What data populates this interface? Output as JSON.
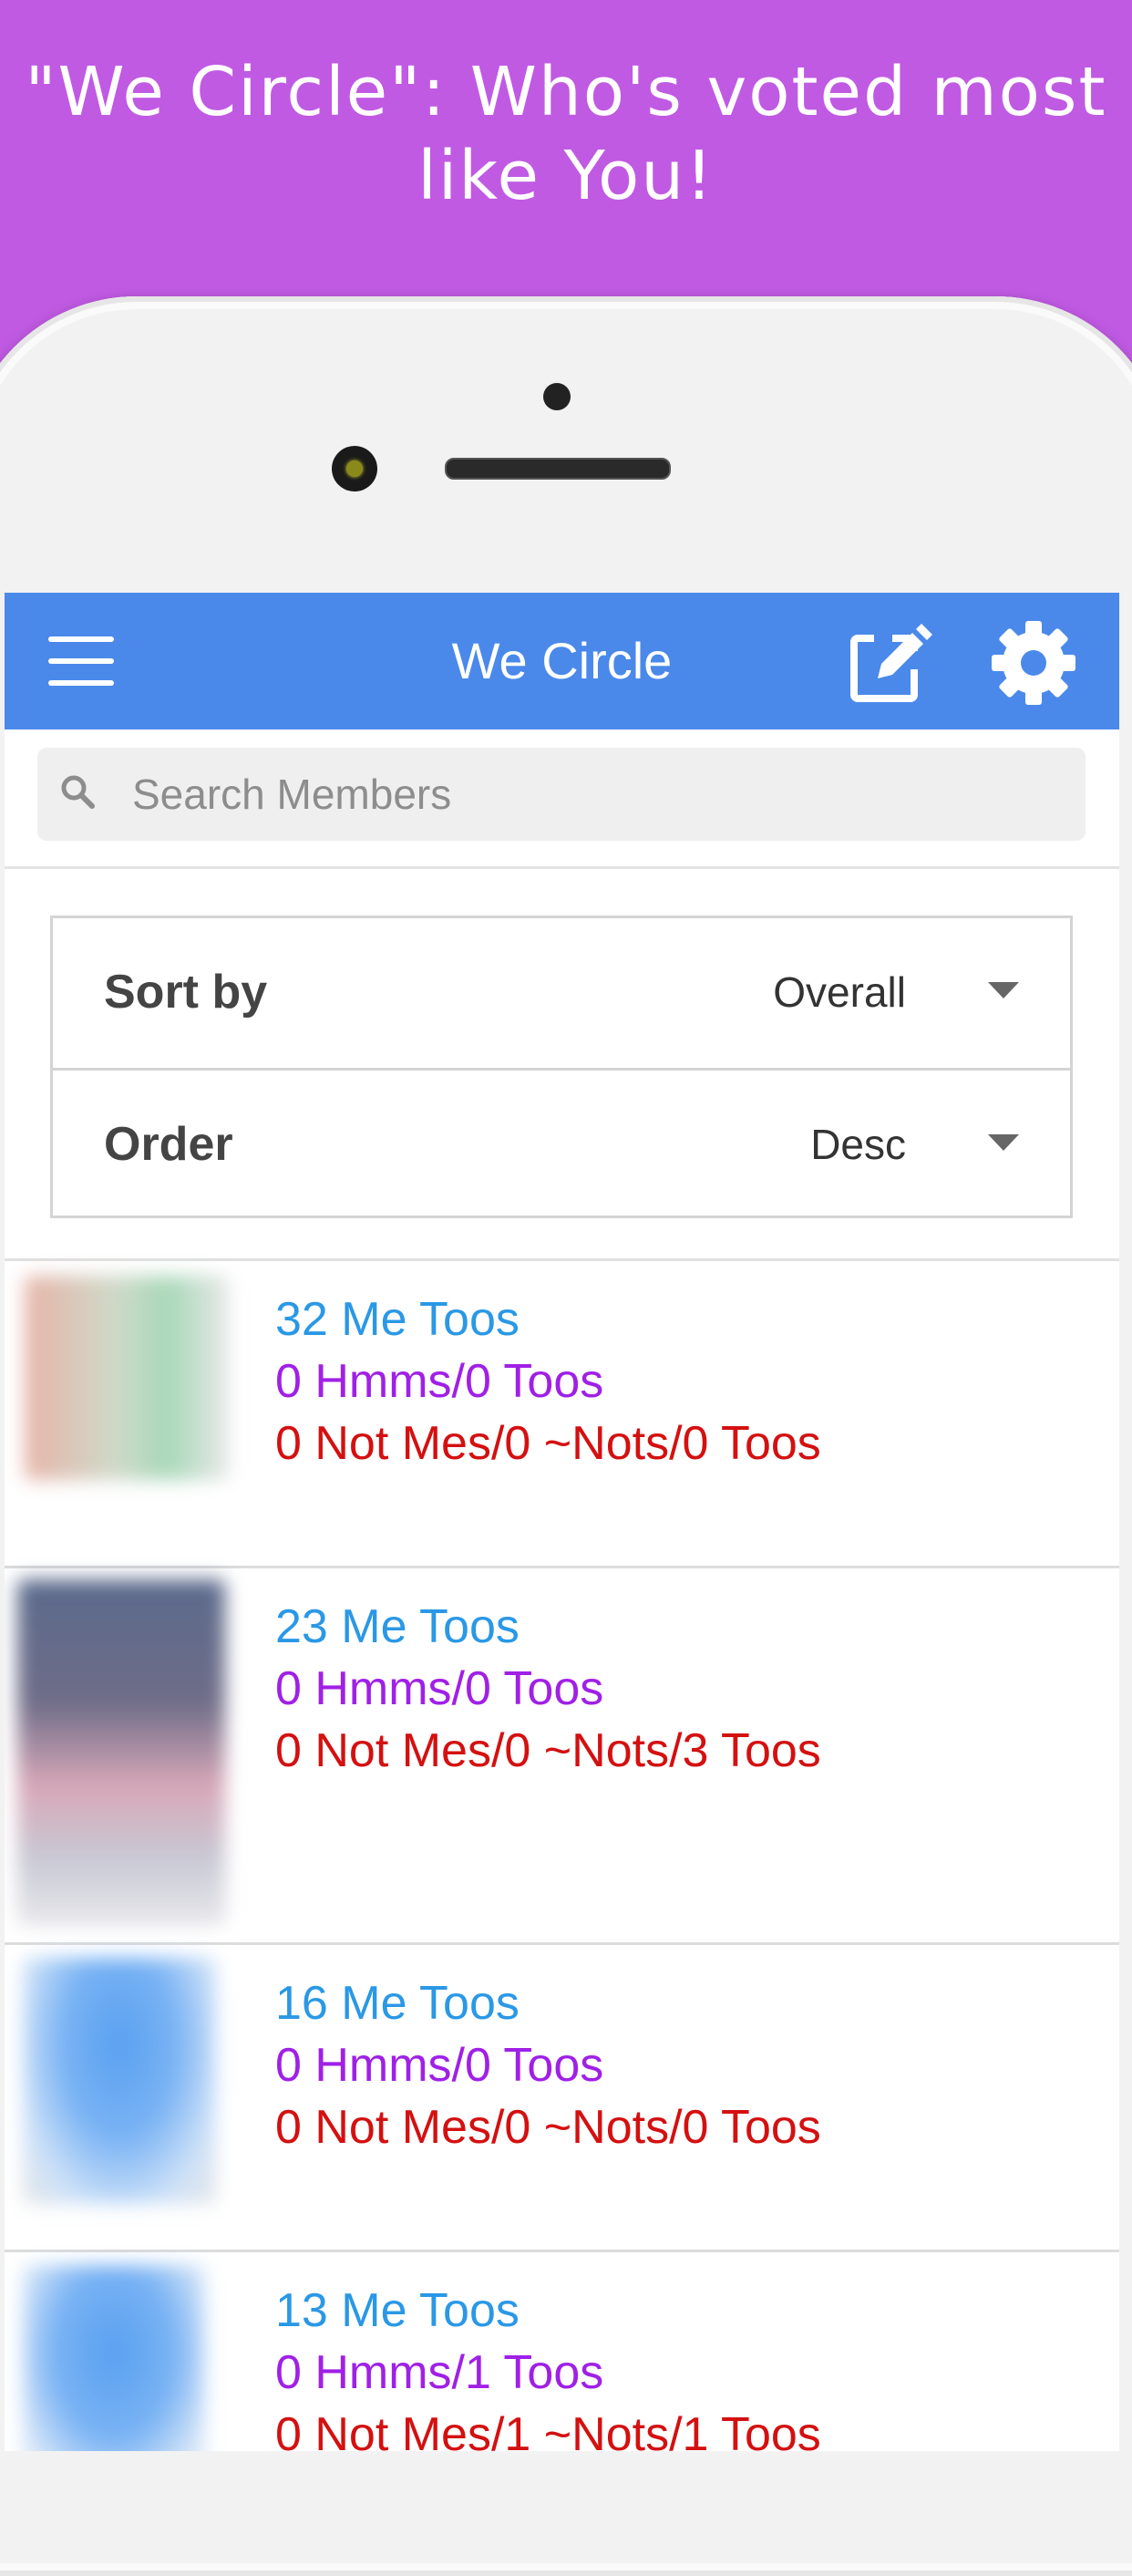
{
  "banner": {
    "line1": "\"We Circle\": Who's voted most",
    "line2": "like You!"
  },
  "appbar": {
    "title": "We Circle"
  },
  "search": {
    "placeholder": "Search Members"
  },
  "filters": {
    "sort_label": "Sort by",
    "sort_value": "Overall",
    "order_label": "Order",
    "order_value": "Desc"
  },
  "members": [
    {
      "me_toos": "32 Me Toos",
      "hmms": "0 Hmms/0 Toos",
      "nots": "0 Not Mes/0 ~Nots/0 Toos"
    },
    {
      "me_toos": "23 Me Toos",
      "hmms": "0 Hmms/0 Toos",
      "nots": "0 Not Mes/0 ~Nots/3 Toos"
    },
    {
      "me_toos": "16 Me Toos",
      "hmms": "0 Hmms/0 Toos",
      "nots": "0 Not Mes/0 ~Nots/0 Toos"
    },
    {
      "me_toos": "13 Me Toos",
      "hmms": "0 Hmms/1 Toos",
      "nots": "0 Not Mes/1 ~Nots/1 Toos"
    }
  ],
  "colors": {
    "banner": "#c05ae3",
    "appbar": "#4a89ea",
    "me_toos": "#2a98e6",
    "hmms": "#a020e6",
    "nots": "#d41010"
  }
}
